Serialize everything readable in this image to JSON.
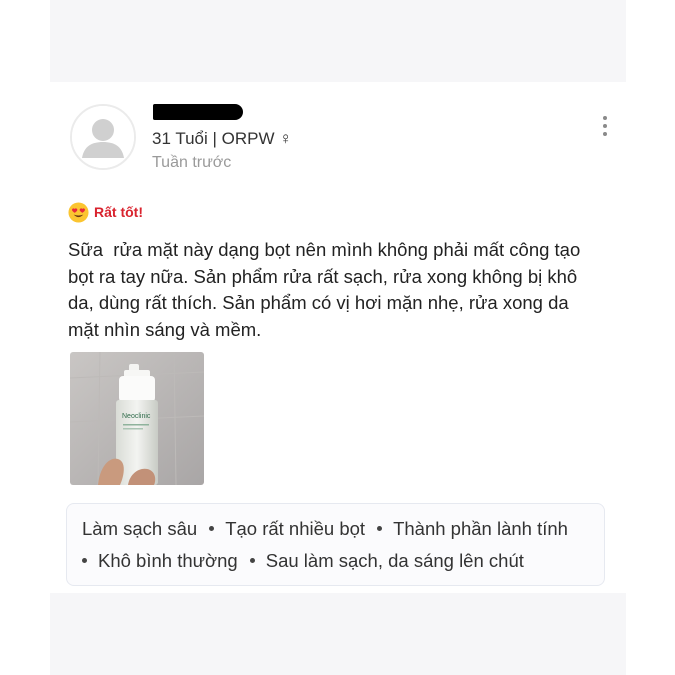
{
  "reviewer": {
    "meta": "31 Tuổi | ORPW ♀",
    "time": "Tuần trước"
  },
  "rating": {
    "emoji": "heart-eyes-emoji",
    "label": "Rất tốt!",
    "color": "#d9232e"
  },
  "review": {
    "text": "Sữa  rửa mặt này dạng bọt nên mình không phải mất công tạo\nbọt ra tay nữa. Sản phẩm rửa rất sạch, rửa xong không bị khô\nda, dùng rất thích. Sản phẩm có vị hơi mặn nhẹ, rửa xong da\nmặt nhìn sáng và mềm."
  },
  "photo": {
    "bottle_label": "Neoclinic"
  },
  "tags": [
    "Làm sạch sâu",
    "Tạo rất nhiều bọt",
    "Thành phần lành tính",
    "Khô bình thường",
    "Sau làm sạch, da sáng lên chút"
  ],
  "icons": {
    "more": "more-vertical-icon",
    "avatar": "default-avatar-icon"
  }
}
